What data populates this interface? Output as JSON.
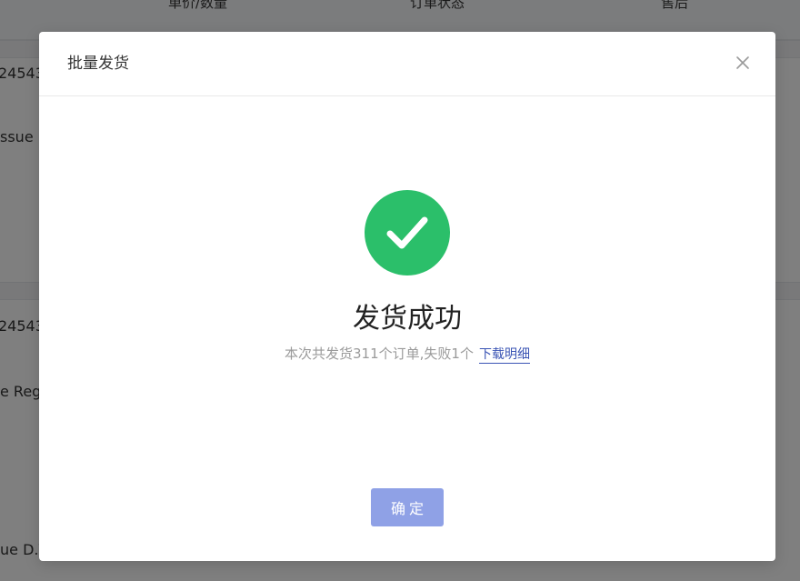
{
  "background": {
    "columns": [
      "单价/数量",
      "订单状态",
      "售后"
    ],
    "cells": [
      "24543",
      "ssue",
      "24543",
      "e Reg",
      "ue D.V"
    ]
  },
  "modal": {
    "title": "批量发货",
    "result_title": "发货成功",
    "result_desc": "本次共发货311个订单,失败1个",
    "download_label": "下载明细",
    "confirm_label": "确定"
  },
  "colors": {
    "success": "#2bbf6a",
    "link": "#3a54b4",
    "confirm_button": "#8fa1e6"
  },
  "icons": {
    "close": "close-icon",
    "success": "check-circle-icon"
  }
}
